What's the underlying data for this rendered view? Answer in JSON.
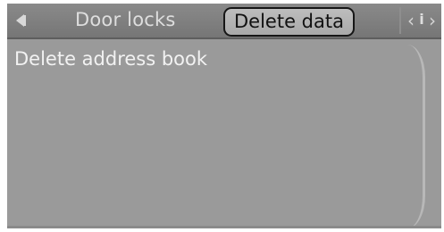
{
  "header": {
    "back_icon": "back-arrow-icon",
    "prev_tab_label": "Door locks",
    "active_tab_label": "Delete data",
    "info_icon": "info-icon",
    "info_label": "i"
  },
  "menu": {
    "items": [
      {
        "label": "Delete address book"
      }
    ]
  },
  "colors": {
    "screen_bg": "#9c9c9c",
    "header_bg": "#767676",
    "active_tab_bg": "#b3b3b3",
    "active_tab_border": "#161616",
    "text_light": "#f2f2f2"
  }
}
